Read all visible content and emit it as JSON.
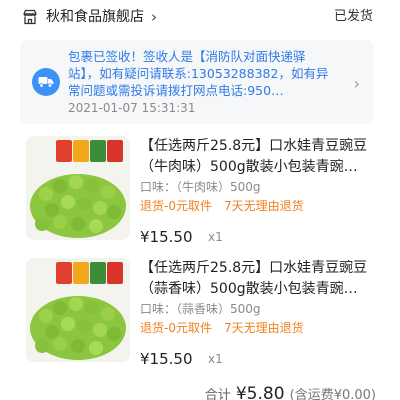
{
  "store": {
    "name": "秋和食品旗舰店",
    "status": "已发货"
  },
  "logistics": {
    "text": "包裹已签收！签收人是【消防队对面快递驿站】，如有疑问请联系:13053288382，如有异常问题或需投诉请拨打网点电话:950…",
    "time": "2021-01-07 15:31:31"
  },
  "products": [
    {
      "title": "【任选两斤25.8元】口水娃青豆豌豆（牛肉味）500g散装小包装青豌…",
      "spec": "口味：（牛肉味）500g",
      "tag_return": "退货-0元取件",
      "tag_7day": "7天无理由退货",
      "price": "¥15.50",
      "qty": "x1"
    },
    {
      "title": "【任选两斤25.8元】口水娃青豆豌豆（蒜香味）500g散装小包装青豌…",
      "spec": "口味：（蒜香味）500g",
      "tag_return": "退货-0元取件",
      "tag_7day": "7天无理由退货",
      "price": "¥15.50",
      "qty": "x1"
    }
  ],
  "total": {
    "label": "合计",
    "amount": "¥5.80",
    "freight": "(含运费¥0.00)"
  },
  "colors": {
    "link_blue": "#2f7be8",
    "tag_orange": "#f0821e",
    "truck_blue": "#3d92f6"
  },
  "icons": [
    "store-icon",
    "chevron-right-icon",
    "truck-icon"
  ]
}
